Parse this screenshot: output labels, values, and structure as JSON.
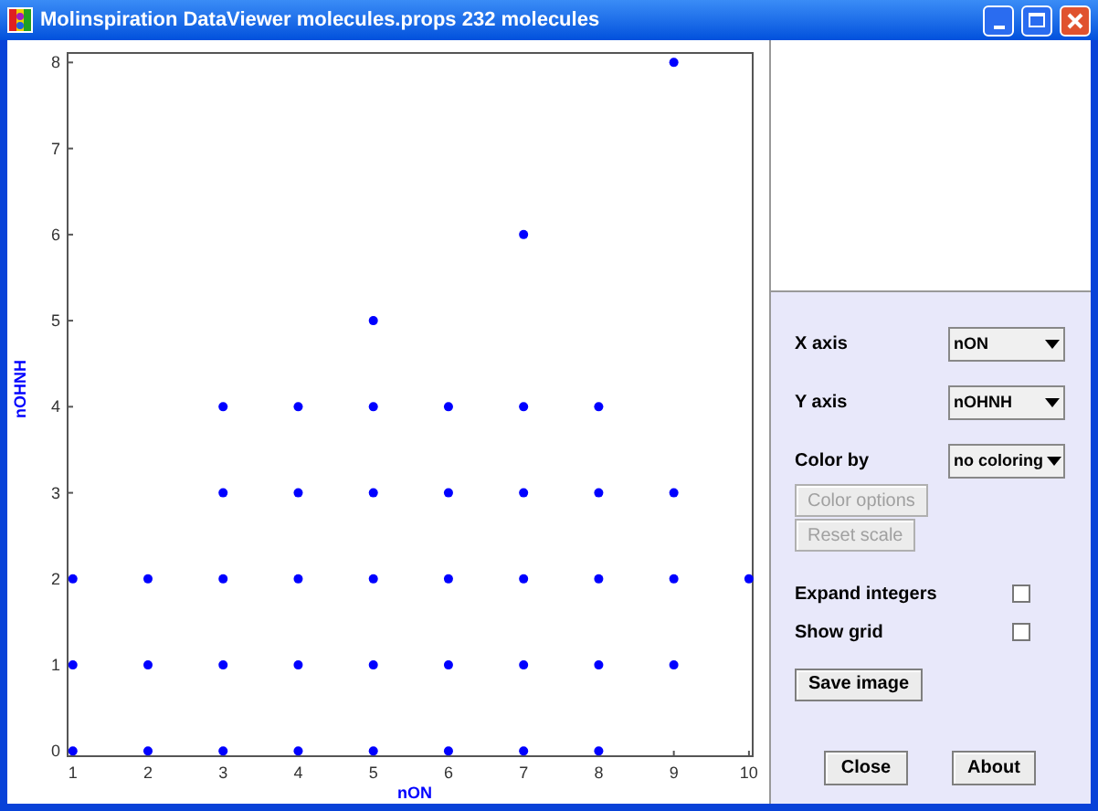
{
  "window": {
    "title": "Molinspiration DataViewer molecules.props 232 molecules"
  },
  "plot": {
    "chart_data": {
      "type": "scatter",
      "xlabel": "nON",
      "ylabel": "nOHNH",
      "x": [
        1,
        1,
        1,
        2,
        2,
        2,
        3,
        3,
        3,
        3,
        3,
        4,
        4,
        4,
        4,
        4,
        5,
        5,
        5,
        5,
        5,
        5,
        6,
        6,
        6,
        6,
        6,
        7,
        7,
        7,
        7,
        7,
        7,
        8,
        8,
        8,
        8,
        8,
        9,
        9,
        9,
        9,
        10
      ],
      "series": [
        {
          "color": "#0000ff",
          "values": [
            0,
            1,
            2,
            0,
            1,
            2,
            0,
            1,
            2,
            3,
            4,
            0,
            1,
            2,
            3,
            4,
            0,
            1,
            2,
            3,
            4,
            5,
            0,
            1,
            2,
            3,
            4,
            0,
            1,
            2,
            3,
            4,
            6,
            0,
            1,
            2,
            3,
            4,
            1,
            2,
            3,
            8,
            2
          ]
        }
      ],
      "xlim": [
        0.93,
        10.05
      ],
      "ylim": [
        -0.06,
        8.11
      ],
      "xticks": [
        1,
        2,
        3,
        4,
        5,
        6,
        7,
        8,
        9,
        10
      ],
      "yticks": [
        0,
        1,
        2,
        3,
        4,
        5,
        6,
        7,
        8
      ]
    }
  },
  "selects": [
    {
      "label": "X axis",
      "value": "nON"
    },
    {
      "label": "Y axis",
      "value": "nOHNH"
    },
    {
      "label": "Color by",
      "value": "no coloring"
    }
  ],
  "action_buttons": [
    {
      "label": "Color options",
      "disabled": true
    },
    {
      "label": "Reset scale",
      "disabled": true
    }
  ],
  "checkboxes": [
    {
      "label": "Expand integers",
      "checked": false
    },
    {
      "label": "Show grid",
      "checked": false
    }
  ],
  "save_button": {
    "label": "Save image"
  },
  "footer_buttons": [
    {
      "label": "Close"
    },
    {
      "label": "About"
    }
  ]
}
